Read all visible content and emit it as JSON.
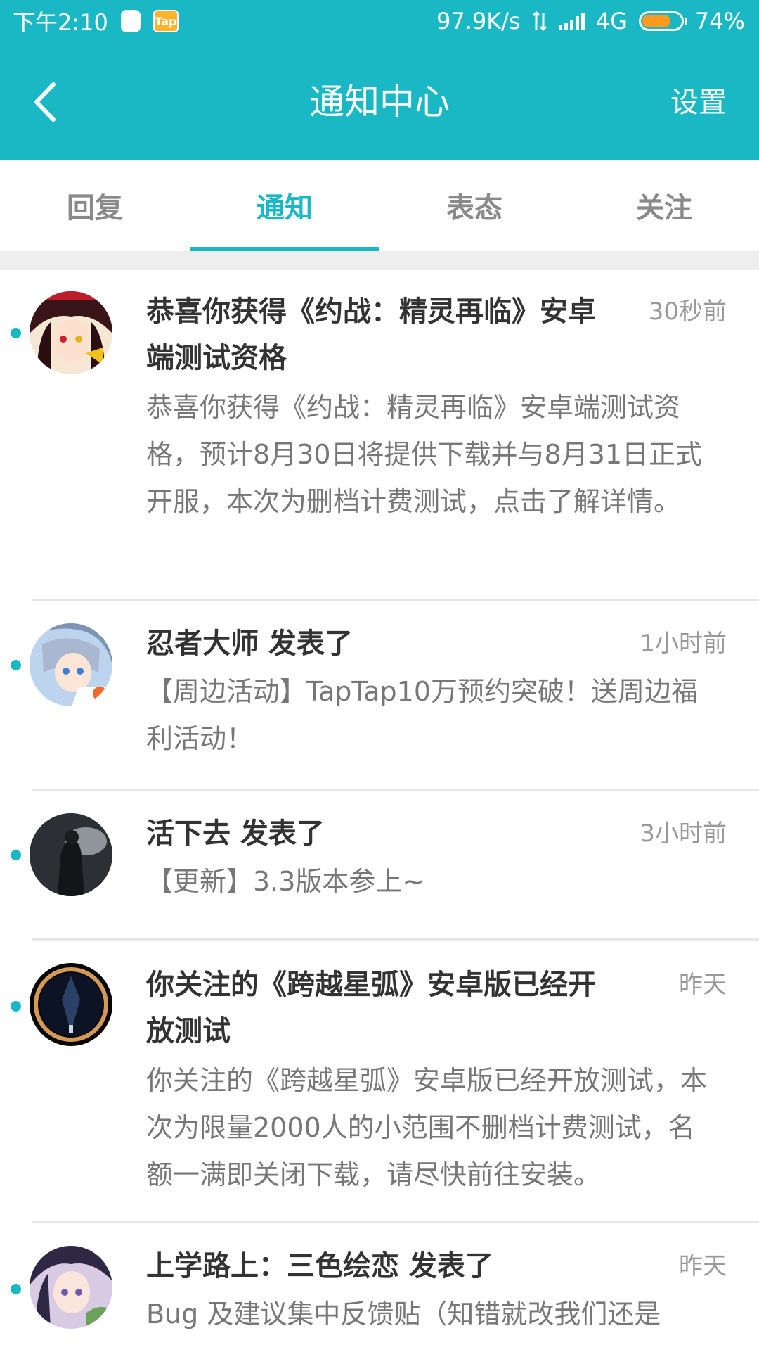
{
  "status_bar": {
    "time": "下午2:10",
    "speed": "97.9K/s",
    "network": "4G",
    "battery_pct": "74%",
    "battery_level": 0.74,
    "icons": [
      "qq-notification-icon",
      "taptap-icon",
      "data-transfer-icon",
      "signal-icon",
      "battery-icon"
    ]
  },
  "header": {
    "title": "通知中心",
    "settings_label": "设置",
    "back_icon": "back-chevron-icon",
    "bg_color": "#1ab8c5"
  },
  "tabs": [
    {
      "label": "回复",
      "active": false
    },
    {
      "label": "通知",
      "active": true
    },
    {
      "label": "表态",
      "active": false
    },
    {
      "label": "关注",
      "active": false
    }
  ],
  "accent_color": "#1ab8c5",
  "notifications": [
    {
      "title": "恭喜你获得《约战：精灵再临》安卓端测试资格",
      "time": "30秒前",
      "body": "恭喜你获得《约战：精灵再临》安卓端测试资格，预计8月30日将提供下载并与8月31日正式开服，本次为删档计费测试，点击了解详情。",
      "unread": true
    },
    {
      "title": "忍者大师 发表了",
      "time": "1小时前",
      "body": "【周边活动】TapTap10万预约突破！送周边福利活动！",
      "unread": true
    },
    {
      "title": "活下去 发表了",
      "time": "3小时前",
      "body": "【更新】3.3版本参上~",
      "unread": true
    },
    {
      "title": "你关注的《跨越星弧》安卓版已经开放测试",
      "time": "昨天",
      "body": "你关注的《跨越星弧》安卓版已经开放测试，本次为限量2000人的小范围不删档计费测试，名额一满即关闭下载，请尽快前往安装。",
      "unread": true
    },
    {
      "title": "上学路上：三色绘恋 发表了",
      "time": "昨天",
      "body": "Bug 及建议集中反馈贴（知错就改我们还是",
      "unread": true
    }
  ]
}
